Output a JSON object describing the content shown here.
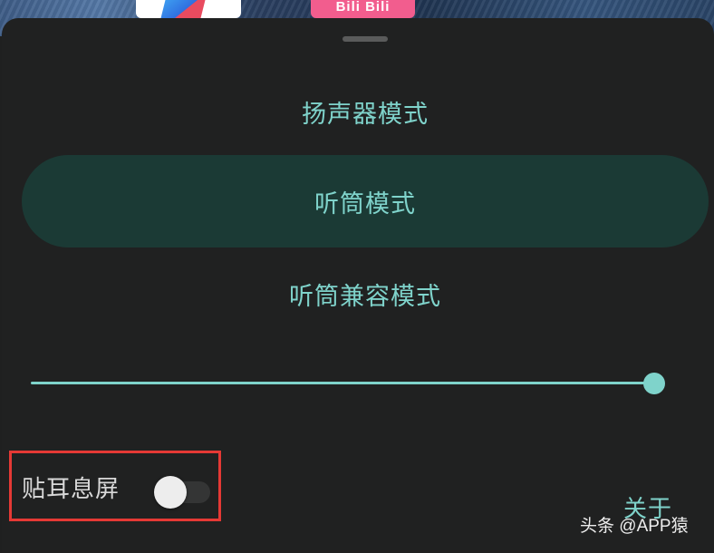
{
  "background": {
    "app_icons": [
      {
        "icon": "browser-app-icon",
        "label": ""
      },
      {
        "icon": "bilibili-app-icon",
        "label": "Bili Bili"
      }
    ]
  },
  "sheet": {
    "modes": [
      {
        "label": "扬声器模式",
        "selected": false
      },
      {
        "label": "听筒模式",
        "selected": true
      },
      {
        "label": "听筒兼容模式",
        "selected": false
      }
    ],
    "volume": {
      "value": 1.0
    },
    "ear_screen_off": {
      "label": "贴耳息屏",
      "enabled": false
    },
    "about_label": "关于"
  },
  "annotation": {
    "highlight_color": "#e53935"
  },
  "watermark": "头条 @APP猿",
  "colors": {
    "accent": "#7fd3cb",
    "selected_bg": "#1b3a35",
    "sheet_bg": "#202121",
    "label_text": "#d9d9d9"
  }
}
